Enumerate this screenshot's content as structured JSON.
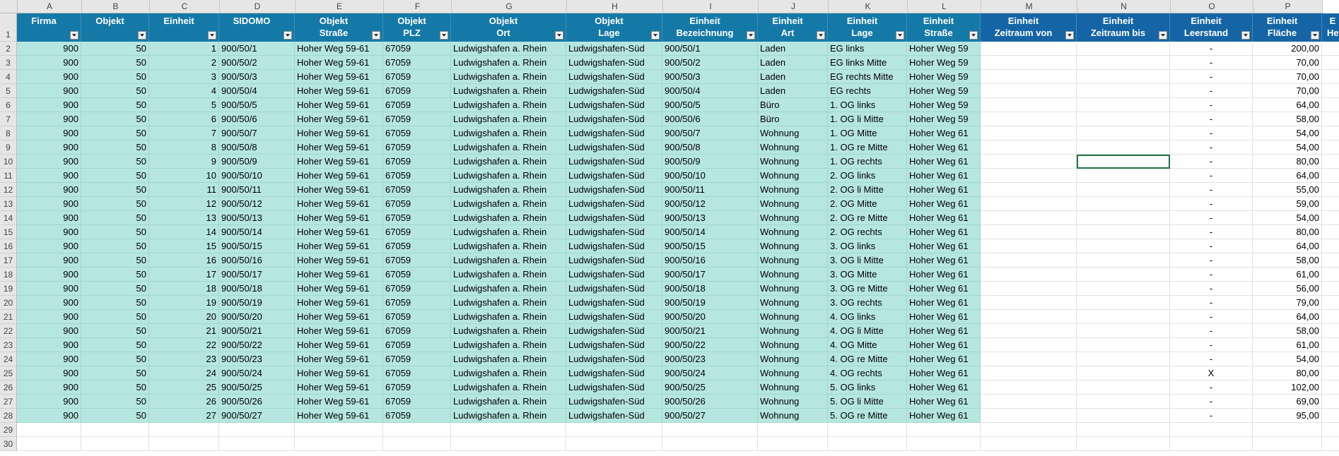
{
  "columns": [
    "A",
    "B",
    "C",
    "D",
    "E",
    "F",
    "G",
    "H",
    "I",
    "J",
    "K",
    "L",
    "M",
    "N",
    "O",
    "P"
  ],
  "headers": [
    {
      "l1": "Firma",
      "l2": ""
    },
    {
      "l1": "Objekt",
      "l2": ""
    },
    {
      "l1": "Einheit",
      "l2": ""
    },
    {
      "l1": "SIDOMO",
      "l2": ""
    },
    {
      "l1": "Objekt",
      "l2": "Straße"
    },
    {
      "l1": "Objekt",
      "l2": "PLZ"
    },
    {
      "l1": "Objekt",
      "l2": "Ort"
    },
    {
      "l1": "Objekt",
      "l2": "Lage"
    },
    {
      "l1": "Einheit",
      "l2": "Bezeichnung"
    },
    {
      "l1": "Einheit",
      "l2": "Art"
    },
    {
      "l1": "Einheit",
      "l2": "Lage"
    },
    {
      "l1": "Einheit",
      "l2": "Straße"
    },
    {
      "l1": "Einheit",
      "l2": "Zeitraum von"
    },
    {
      "l1": "Einheit",
      "l2": "Zeitraum bis"
    },
    {
      "l1": "Einheit",
      "l2": "Leerstand"
    },
    {
      "l1": "Einheit",
      "l2": "Fläche"
    },
    {
      "l1": "E",
      "l2": "He"
    }
  ],
  "rows": [
    [
      "900",
      "50",
      "1",
      "900/50/1",
      "Hoher Weg 59-61",
      "67059",
      "Ludwigshafen a. Rhein",
      "Ludwigshafen-Süd",
      "900/50/1",
      "Laden",
      "EG links",
      "Hoher Weg 59",
      "",
      "",
      "-",
      "200,00"
    ],
    [
      "900",
      "50",
      "2",
      "900/50/2",
      "Hoher Weg 59-61",
      "67059",
      "Ludwigshafen a. Rhein",
      "Ludwigshafen-Süd",
      "900/50/2",
      "Laden",
      "EG links Mitte",
      "Hoher Weg 59",
      "",
      "",
      "-",
      "70,00"
    ],
    [
      "900",
      "50",
      "3",
      "900/50/3",
      "Hoher Weg 59-61",
      "67059",
      "Ludwigshafen a. Rhein",
      "Ludwigshafen-Süd",
      "900/50/3",
      "Laden",
      "EG rechts Mitte",
      "Hoher Weg 59",
      "",
      "",
      "-",
      "70,00"
    ],
    [
      "900",
      "50",
      "4",
      "900/50/4",
      "Hoher Weg 59-61",
      "67059",
      "Ludwigshafen a. Rhein",
      "Ludwigshafen-Süd",
      "900/50/4",
      "Laden",
      "EG rechts",
      "Hoher Weg 59",
      "",
      "",
      "-",
      "70,00"
    ],
    [
      "900",
      "50",
      "5",
      "900/50/5",
      "Hoher Weg 59-61",
      "67059",
      "Ludwigshafen a. Rhein",
      "Ludwigshafen-Süd",
      "900/50/5",
      "Büro",
      "1. OG links",
      "Hoher Weg 59",
      "",
      "",
      "-",
      "64,00"
    ],
    [
      "900",
      "50",
      "6",
      "900/50/6",
      "Hoher Weg 59-61",
      "67059",
      "Ludwigshafen a. Rhein",
      "Ludwigshafen-Süd",
      "900/50/6",
      "Büro",
      "1. OG li Mitte",
      "Hoher Weg 59",
      "",
      "",
      "-",
      "58,00"
    ],
    [
      "900",
      "50",
      "7",
      "900/50/7",
      "Hoher Weg 59-61",
      "67059",
      "Ludwigshafen a. Rhein",
      "Ludwigshafen-Süd",
      "900/50/7",
      "Wohnung",
      "1. OG Mitte",
      "Hoher Weg 61",
      "",
      "",
      "-",
      "54,00"
    ],
    [
      "900",
      "50",
      "8",
      "900/50/8",
      "Hoher Weg 59-61",
      "67059",
      "Ludwigshafen a. Rhein",
      "Ludwigshafen-Süd",
      "900/50/8",
      "Wohnung",
      "1. OG re Mitte",
      "Hoher Weg 61",
      "",
      "",
      "-",
      "54,00"
    ],
    [
      "900",
      "50",
      "9",
      "900/50/9",
      "Hoher Weg 59-61",
      "67059",
      "Ludwigshafen a. Rhein",
      "Ludwigshafen-Süd",
      "900/50/9",
      "Wohnung",
      "1. OG rechts",
      "Hoher Weg 61",
      "",
      "",
      "-",
      "80,00"
    ],
    [
      "900",
      "50",
      "10",
      "900/50/10",
      "Hoher Weg 59-61",
      "67059",
      "Ludwigshafen a. Rhein",
      "Ludwigshafen-Süd",
      "900/50/10",
      "Wohnung",
      "2. OG links",
      "Hoher Weg 61",
      "",
      "",
      "-",
      "64,00"
    ],
    [
      "900",
      "50",
      "11",
      "900/50/11",
      "Hoher Weg 59-61",
      "67059",
      "Ludwigshafen a. Rhein",
      "Ludwigshafen-Süd",
      "900/50/11",
      "Wohnung",
      "2. OG li Mitte",
      "Hoher Weg 61",
      "",
      "",
      "-",
      "55,00"
    ],
    [
      "900",
      "50",
      "12",
      "900/50/12",
      "Hoher Weg 59-61",
      "67059",
      "Ludwigshafen a. Rhein",
      "Ludwigshafen-Süd",
      "900/50/12",
      "Wohnung",
      "2. OG Mitte",
      "Hoher Weg 61",
      "",
      "",
      "-",
      "59,00"
    ],
    [
      "900",
      "50",
      "13",
      "900/50/13",
      "Hoher Weg 59-61",
      "67059",
      "Ludwigshafen a. Rhein",
      "Ludwigshafen-Süd",
      "900/50/13",
      "Wohnung",
      "2. OG re Mitte",
      "Hoher Weg 61",
      "",
      "",
      "-",
      "54,00"
    ],
    [
      "900",
      "50",
      "14",
      "900/50/14",
      "Hoher Weg 59-61",
      "67059",
      "Ludwigshafen a. Rhein",
      "Ludwigshafen-Süd",
      "900/50/14",
      "Wohnung",
      "2. OG rechts",
      "Hoher Weg 61",
      "",
      "",
      "-",
      "80,00"
    ],
    [
      "900",
      "50",
      "15",
      "900/50/15",
      "Hoher Weg 59-61",
      "67059",
      "Ludwigshafen a. Rhein",
      "Ludwigshafen-Süd",
      "900/50/15",
      "Wohnung",
      "3. OG links",
      "Hoher Weg 61",
      "",
      "",
      "-",
      "64,00"
    ],
    [
      "900",
      "50",
      "16",
      "900/50/16",
      "Hoher Weg 59-61",
      "67059",
      "Ludwigshafen a. Rhein",
      "Ludwigshafen-Süd",
      "900/50/16",
      "Wohnung",
      "3. OG li Mitte",
      "Hoher Weg 61",
      "",
      "",
      "-",
      "58,00"
    ],
    [
      "900",
      "50",
      "17",
      "900/50/17",
      "Hoher Weg 59-61",
      "67059",
      "Ludwigshafen a. Rhein",
      "Ludwigshafen-Süd",
      "900/50/17",
      "Wohnung",
      "3. OG Mitte",
      "Hoher Weg 61",
      "",
      "",
      "-",
      "61,00"
    ],
    [
      "900",
      "50",
      "18",
      "900/50/18",
      "Hoher Weg 59-61",
      "67059",
      "Ludwigshafen a. Rhein",
      "Ludwigshafen-Süd",
      "900/50/18",
      "Wohnung",
      "3. OG re Mitte",
      "Hoher Weg 61",
      "",
      "",
      "-",
      "56,00"
    ],
    [
      "900",
      "50",
      "19",
      "900/50/19",
      "Hoher Weg 59-61",
      "67059",
      "Ludwigshafen a. Rhein",
      "Ludwigshafen-Süd",
      "900/50/19",
      "Wohnung",
      "3. OG rechts",
      "Hoher Weg 61",
      "",
      "",
      "-",
      "79,00"
    ],
    [
      "900",
      "50",
      "20",
      "900/50/20",
      "Hoher Weg 59-61",
      "67059",
      "Ludwigshafen a. Rhein",
      "Ludwigshafen-Süd",
      "900/50/20",
      "Wohnung",
      "4. OG links",
      "Hoher Weg 61",
      "",
      "",
      "-",
      "64,00"
    ],
    [
      "900",
      "50",
      "21",
      "900/50/21",
      "Hoher Weg 59-61",
      "67059",
      "Ludwigshafen a. Rhein",
      "Ludwigshafen-Süd",
      "900/50/21",
      "Wohnung",
      "4. OG li Mitte",
      "Hoher Weg 61",
      "",
      "",
      "-",
      "58,00"
    ],
    [
      "900",
      "50",
      "22",
      "900/50/22",
      "Hoher Weg 59-61",
      "67059",
      "Ludwigshafen a. Rhein",
      "Ludwigshafen-Süd",
      "900/50/22",
      "Wohnung",
      "4. OG Mitte",
      "Hoher Weg 61",
      "",
      "",
      "-",
      "61,00"
    ],
    [
      "900",
      "50",
      "23",
      "900/50/23",
      "Hoher Weg 59-61",
      "67059",
      "Ludwigshafen a. Rhein",
      "Ludwigshafen-Süd",
      "900/50/23",
      "Wohnung",
      "4. OG re Mitte",
      "Hoher Weg 61",
      "",
      "",
      "-",
      "54,00"
    ],
    [
      "900",
      "50",
      "24",
      "900/50/24",
      "Hoher Weg 59-61",
      "67059",
      "Ludwigshafen a. Rhein",
      "Ludwigshafen-Süd",
      "900/50/24",
      "Wohnung",
      "4. OG rechts",
      "Hoher Weg 61",
      "",
      "",
      "X",
      "80,00"
    ],
    [
      "900",
      "50",
      "25",
      "900/50/25",
      "Hoher Weg 59-61",
      "67059",
      "Ludwigshafen a. Rhein",
      "Ludwigshafen-Süd",
      "900/50/25",
      "Wohnung",
      "5. OG links",
      "Hoher Weg 61",
      "",
      "",
      "-",
      "102,00"
    ],
    [
      "900",
      "50",
      "26",
      "900/50/26",
      "Hoher Weg 59-61",
      "67059",
      "Ludwigshafen a. Rhein",
      "Ludwigshafen-Süd",
      "900/50/26",
      "Wohnung",
      "5. OG li Mitte",
      "Hoher Weg 61",
      "",
      "",
      "-",
      "69,00"
    ],
    [
      "900",
      "50",
      "27",
      "900/50/27",
      "Hoher Weg 59-61",
      "67059",
      "Ludwigshafen a. Rhein",
      "Ludwigshafen-Süd",
      "900/50/27",
      "Wohnung",
      "5. OG re Mitte",
      "Hoher Weg 61",
      "",
      "",
      "-",
      "95,00"
    ]
  ],
  "empty_rows": [
    "29",
    "30"
  ],
  "colors": {
    "table_header": "#1579a8",
    "pivot_header": "#1565a6",
    "table_cell": "#b6e6e0",
    "selection": "#217346"
  }
}
